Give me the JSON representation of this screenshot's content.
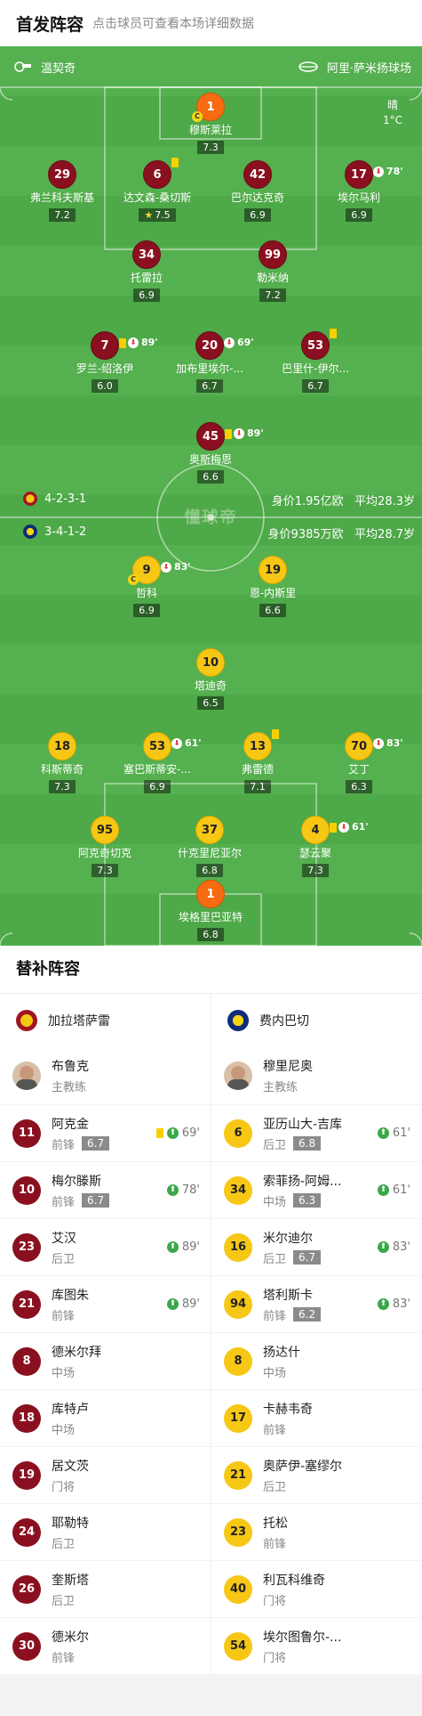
{
  "header": {
    "title": "首发阵容",
    "subtitle": "点击球员可查看本场详细数据"
  },
  "pitch": {
    "home_team": "温契奇",
    "venue": "阿里·萨米扬球场",
    "weather": "晴",
    "temperature": "1°C",
    "watermark": "懂球帝",
    "home_formation": "4-2-3-1",
    "home_value": "身价1.95亿欧",
    "home_age": "平均28.3岁",
    "away_formation": "3-4-1-2",
    "away_value": "身价9385万欧",
    "away_age": "平均28.7岁",
    "home_players": [
      {
        "num": "1",
        "name": "穆斯莱拉",
        "rating": "7.3",
        "color": "org",
        "captain": "C"
      },
      {
        "num": "29",
        "name": "弗兰科夫斯基",
        "rating": "7.2",
        "color": "red"
      },
      {
        "num": "6",
        "name": "达文森-桑切斯",
        "rating": "7.5",
        "color": "red",
        "star": true,
        "yellow": true
      },
      {
        "num": "42",
        "name": "巴尔达克奇",
        "rating": "6.9",
        "color": "red"
      },
      {
        "num": "17",
        "name": "埃尔马利",
        "rating": "6.9",
        "color": "red",
        "sub_min": "78'"
      },
      {
        "num": "34",
        "name": "托雷拉",
        "rating": "6.9",
        "color": "red"
      },
      {
        "num": "99",
        "name": "勒米纳",
        "rating": "7.2",
        "color": "red"
      },
      {
        "num": "7",
        "name": "罗兰-绍洛伊",
        "rating": "6.0",
        "color": "red",
        "yellow": true,
        "sub_min": "89'"
      },
      {
        "num": "20",
        "name": "加布里埃尔-...",
        "rating": "6.7",
        "color": "red",
        "sub_min": "69'"
      },
      {
        "num": "53",
        "name": "巴里什-伊尔...",
        "rating": "6.7",
        "color": "red",
        "yellow": true
      },
      {
        "num": "45",
        "name": "奥斯梅恩",
        "rating": "6.6",
        "color": "red",
        "yellow": true,
        "sub_min": "89'"
      }
    ],
    "away_players": [
      {
        "num": "9",
        "name": "哲科",
        "rating": "6.9",
        "color": "yel",
        "captain": "C",
        "sub_min": "83'"
      },
      {
        "num": "19",
        "name": "恩-内斯里",
        "rating": "6.6",
        "color": "yel"
      },
      {
        "num": "10",
        "name": "塔迪奇",
        "rating": "6.5",
        "color": "yel"
      },
      {
        "num": "18",
        "name": "科斯蒂奇",
        "rating": "7.3",
        "color": "yel"
      },
      {
        "num": "53",
        "name": "塞巴斯蒂安-...",
        "rating": "6.9",
        "color": "yel",
        "sub_min": "61'"
      },
      {
        "num": "13",
        "name": "弗雷德",
        "rating": "7.1",
        "color": "yel",
        "yellow": true
      },
      {
        "num": "70",
        "name": "艾丁",
        "rating": "6.3",
        "color": "yel",
        "sub_min": "83'"
      },
      {
        "num": "95",
        "name": "阿克奇切克",
        "rating": "7.3",
        "color": "yel"
      },
      {
        "num": "37",
        "name": "什克里尼亚尔",
        "rating": "6.8",
        "color": "yel"
      },
      {
        "num": "4",
        "name": "瑟云聚",
        "rating": "7.3",
        "color": "yel",
        "yellow": true,
        "sub_min": "61'"
      },
      {
        "num": "1",
        "name": "埃格里巴亚特",
        "rating": "6.8",
        "color": "org"
      }
    ]
  },
  "subs": {
    "title": "替补阵容",
    "home": {
      "team": "加拉塔萨雷",
      "coach_name": "布鲁克",
      "coach_role": "主教练",
      "players": [
        {
          "num": "11",
          "name": "阿克金",
          "pos": "前锋",
          "rating": "6.7",
          "yellow": true,
          "in_min": "69'"
        },
        {
          "num": "10",
          "name": "梅尔滕斯",
          "pos": "前锋",
          "rating": "6.7",
          "in_min": "78'"
        },
        {
          "num": "23",
          "name": "艾汉",
          "pos": "后卫",
          "in_min": "89'"
        },
        {
          "num": "21",
          "name": "库图朱",
          "pos": "前锋",
          "in_min": "89'"
        },
        {
          "num": "8",
          "name": "德米尔拜",
          "pos": "中场"
        },
        {
          "num": "18",
          "name": "库特卢",
          "pos": "中场"
        },
        {
          "num": "19",
          "name": "居文茨",
          "pos": "门将"
        },
        {
          "num": "24",
          "name": "耶勒特",
          "pos": "后卫"
        },
        {
          "num": "26",
          "name": "奎斯塔",
          "pos": "后卫"
        },
        {
          "num": "30",
          "name": "德米尔",
          "pos": "前锋"
        }
      ]
    },
    "away": {
      "team": "费内巴切",
      "coach_name": "穆里尼奥",
      "coach_role": "主教练",
      "players": [
        {
          "num": "6",
          "name": "亚历山大-吉库",
          "pos": "后卫",
          "rating": "6.8",
          "in_min": "61'"
        },
        {
          "num": "34",
          "name": "索菲扬-阿姆...",
          "pos": "中场",
          "rating": "6.3",
          "in_min": "61'"
        },
        {
          "num": "16",
          "name": "米尔迪尔",
          "pos": "后卫",
          "rating": "6.7",
          "in_min": "83'"
        },
        {
          "num": "94",
          "name": "塔利斯卡",
          "pos": "前锋",
          "rating": "6.2",
          "in_min": "83'"
        },
        {
          "num": "8",
          "name": "扬达什",
          "pos": "中场"
        },
        {
          "num": "17",
          "name": "卡赫韦奇",
          "pos": "前锋"
        },
        {
          "num": "21",
          "name": "奥萨伊-塞缪尔",
          "pos": "后卫"
        },
        {
          "num": "23",
          "name": "托松",
          "pos": "前锋"
        },
        {
          "num": "40",
          "name": "利瓦科维奇",
          "pos": "门将"
        },
        {
          "num": "54",
          "name": "埃尔图鲁尔-...",
          "pos": "门将"
        }
      ]
    }
  },
  "colors": {
    "home": "#8a1020",
    "away": "#f7c716",
    "pitch": "#55b04f",
    "keeper": "#f76c12"
  }
}
